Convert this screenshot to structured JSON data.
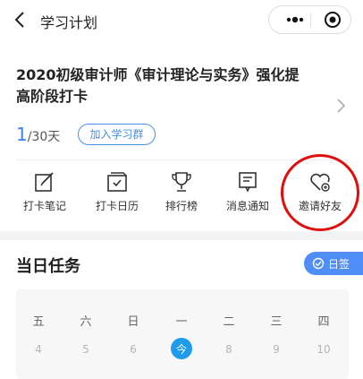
{
  "nav": {
    "title": "学习计划"
  },
  "plan": {
    "title": "2020初级审计师《审计理论与实务》强化提高阶段打卡",
    "progress_current": "1",
    "progress_total": "/30天",
    "group_button": "加入学习群"
  },
  "shortcuts": [
    {
      "label": "打卡笔记",
      "icon": "note-edit-icon"
    },
    {
      "label": "打卡日历",
      "icon": "calendar-icon"
    },
    {
      "label": "排行榜",
      "icon": "trophy-icon"
    },
    {
      "label": "消息通知",
      "icon": "message-icon"
    },
    {
      "label": "邀请好友",
      "icon": "invite-heart-icon"
    }
  ],
  "tasks": {
    "title": "当日任务",
    "sign_button": "日签",
    "weekdays": [
      "五",
      "六",
      "日",
      "一",
      "二",
      "三",
      "四"
    ],
    "dates": [
      "4",
      "5",
      "6",
      "今",
      "8",
      "9",
      "10"
    ],
    "today_index": 3
  },
  "colors": {
    "accent": "#1e9bea",
    "button_blue": "#4f8ef7",
    "highlight_circle": "#e10d0d"
  }
}
